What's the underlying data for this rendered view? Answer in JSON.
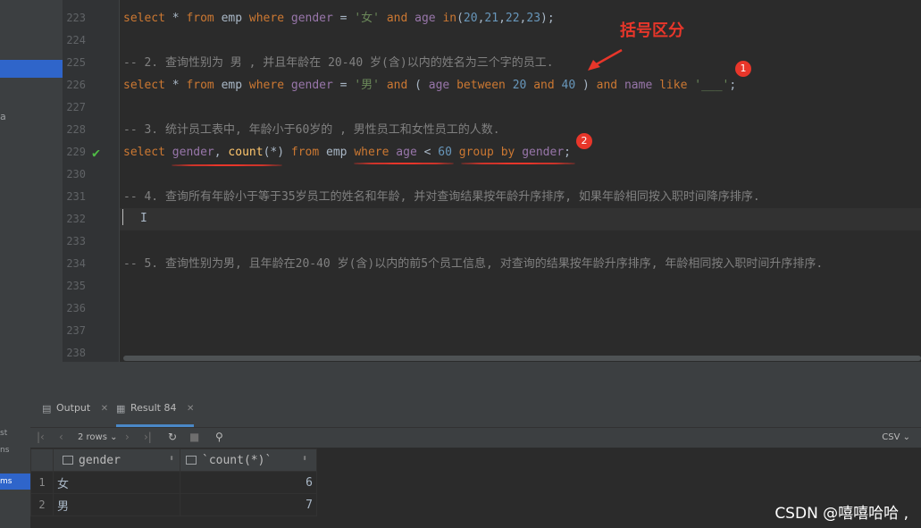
{
  "editor": {
    "lines": [
      {
        "num": "223",
        "tokens": [
          [
            "kw",
            "select "
          ],
          [
            "",
            "* "
          ],
          [
            "kw",
            "from "
          ],
          [
            "",
            "emp "
          ],
          [
            "kw",
            "where "
          ],
          [
            "col",
            "gender"
          ],
          [
            "",
            " = "
          ],
          [
            "str",
            "'女'"
          ],
          [
            "",
            " "
          ],
          [
            "kw",
            "and "
          ],
          [
            "col",
            "age "
          ],
          [
            "kw",
            "in"
          ],
          [
            "",
            "("
          ],
          [
            "num",
            "20"
          ],
          [
            "",
            ","
          ],
          [
            "num",
            "21"
          ],
          [
            "",
            ","
          ],
          [
            "num",
            "22"
          ],
          [
            "",
            ","
          ],
          [
            "num",
            "23"
          ],
          [
            "",
            ");"
          ]
        ]
      },
      {
        "num": "224",
        "tokens": []
      },
      {
        "num": "225",
        "tokens": [
          [
            "com",
            "-- 2. 查询性别为 男 , 并且年龄在 20-40 岁(含)以内的姓名为三个字的员工."
          ]
        ]
      },
      {
        "num": "226",
        "tokens": [
          [
            "kw",
            "select "
          ],
          [
            "",
            "* "
          ],
          [
            "kw",
            "from "
          ],
          [
            "",
            "emp "
          ],
          [
            "kw",
            "where "
          ],
          [
            "col",
            "gender"
          ],
          [
            "",
            " = "
          ],
          [
            "str",
            "'男'"
          ],
          [
            "",
            " "
          ],
          [
            "kw",
            "and "
          ],
          [
            "",
            "( "
          ],
          [
            "col",
            "age "
          ],
          [
            "kw",
            "between "
          ],
          [
            "num",
            "20 "
          ],
          [
            "kw",
            "and "
          ],
          [
            "num",
            "40"
          ],
          [
            "",
            " ) "
          ],
          [
            "kw",
            "and "
          ],
          [
            "col",
            "name "
          ],
          [
            "kw",
            "like "
          ],
          [
            "str",
            "'___'"
          ],
          [
            "",
            ";"
          ]
        ]
      },
      {
        "num": "227",
        "tokens": []
      },
      {
        "num": "228",
        "tokens": [
          [
            "com",
            "-- 3. 统计员工表中, 年龄小于60岁的 , 男性员工和女性员工的人数."
          ]
        ]
      },
      {
        "num": "229",
        "tokens": [
          [
            "kw",
            "select "
          ],
          [
            "col",
            "gender"
          ],
          [
            "",
            ", "
          ],
          [
            "fn",
            "count"
          ],
          [
            "",
            "(*) "
          ],
          [
            "kw",
            "from "
          ],
          [
            "",
            "emp "
          ],
          [
            "kw",
            "where "
          ],
          [
            "col",
            "age"
          ],
          [
            "",
            " < "
          ],
          [
            "num",
            "60"
          ],
          [
            "",
            " "
          ],
          [
            "kw",
            "group by "
          ],
          [
            "col",
            "gender"
          ],
          [
            "",
            ";"
          ]
        ]
      },
      {
        "num": "230",
        "tokens": []
      },
      {
        "num": "231",
        "tokens": [
          [
            "com",
            "-- 4. 查询所有年龄小于等于35岁员工的姓名和年龄, 并对查询结果按年龄升序排序, 如果年龄相同按入职时间降序排序."
          ]
        ]
      },
      {
        "num": "232",
        "tokens": []
      },
      {
        "num": "233",
        "tokens": []
      },
      {
        "num": "234",
        "tokens": [
          [
            "com",
            "-- 5. 查询性别为男, 且年龄在20-40 岁(含)以内的前5个员工信息, 对查询的结果按年龄升序排序, 年龄相同按入职时间升序排序."
          ]
        ]
      },
      {
        "num": "235",
        "tokens": []
      },
      {
        "num": "236",
        "tokens": []
      },
      {
        "num": "237",
        "tokens": []
      },
      {
        "num": "238",
        "tokens": []
      }
    ]
  },
  "annotation": {
    "note": "括号区分",
    "badge1": "1",
    "badge2": "2"
  },
  "left_fragments": [
    "a"
  ],
  "side_fragments": [
    "st",
    "ns",
    "ms"
  ],
  "tabs": [
    {
      "label": "Output",
      "icon": "output-icon"
    },
    {
      "label": "Result 84",
      "icon": "table-icon"
    }
  ],
  "toolbar": {
    "rows_label": "2 rows",
    "format_label": "CSV"
  },
  "result": {
    "columns": [
      "gender",
      "`count(*)`"
    ],
    "rows": [
      {
        "n": "1",
        "gender": "女",
        "count": "6"
      },
      {
        "n": "2",
        "gender": "男",
        "count": "7"
      }
    ]
  },
  "watermark": "CSDN @嘻嘻哈哈 ,",
  "colors": {
    "keyword": "#cc7832",
    "string": "#6a8759",
    "number": "#6897bb",
    "comment": "#808080",
    "column": "#9876aa",
    "annotation": "#e8362a"
  }
}
